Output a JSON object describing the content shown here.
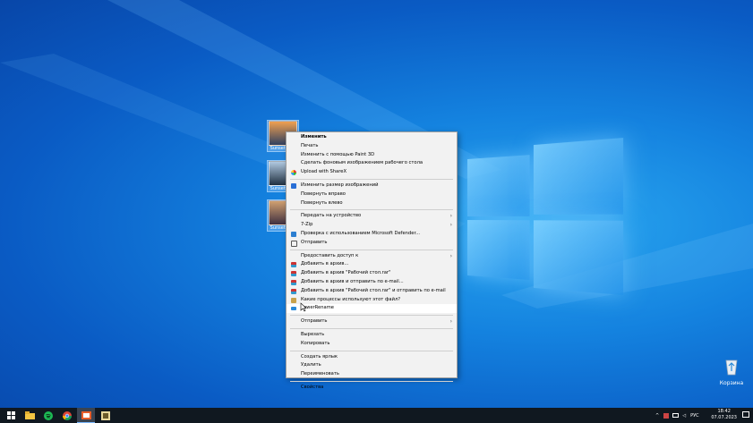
{
  "desktop": {
    "icons": [
      {
        "label": "Sunset_city"
      },
      {
        "label": "Sunset_city"
      },
      {
        "label": "Sunset_city"
      }
    ],
    "recycle_bin": {
      "label": "Корзина"
    }
  },
  "context_menu": {
    "items": [
      {
        "label": "Изменить"
      },
      {
        "label": "Печать"
      },
      {
        "label": "Изменить с помощью Paint 3D"
      },
      {
        "label": "Сделать фоновым изображением рабочего стола"
      },
      {
        "label": "Upload with ShareX"
      },
      {
        "label": "Изменить размер изображений"
      },
      {
        "label": "Повернуть вправо"
      },
      {
        "label": "Повернуть влево"
      },
      {
        "label": "Передать на устройство"
      },
      {
        "label": "7-Zip"
      },
      {
        "label": "Проверка с использованием Microsoft Defender..."
      },
      {
        "label": "Отправить"
      },
      {
        "label": "Предоставить доступ к"
      },
      {
        "label": "Добавить в архив..."
      },
      {
        "label": "Добавить в архив \"Рабочий стол.rar\""
      },
      {
        "label": "Добавить в архив и отправить по e-mail..."
      },
      {
        "label": "Добавить в архив \"Рабочий стол.rar\" и отправить по e-mail"
      },
      {
        "label": "Какие процессы используют этот файл?"
      },
      {
        "label": "PowerRename"
      },
      {
        "label": "Отправить"
      },
      {
        "label": "Вырезать"
      },
      {
        "label": "Копировать"
      },
      {
        "label": "Создать ярлык"
      },
      {
        "label": "Удалить"
      },
      {
        "label": "Переименовать"
      },
      {
        "label": "Свойства"
      }
    ]
  },
  "taskbar": {
    "language": "РУС",
    "time": "18:42",
    "date": "07.07.2023"
  },
  "colors": {
    "menu_bg": "#f2f2f2",
    "highlight": "#ffffff",
    "taskbar": "#101820",
    "desktop_accent": "#1482df"
  }
}
